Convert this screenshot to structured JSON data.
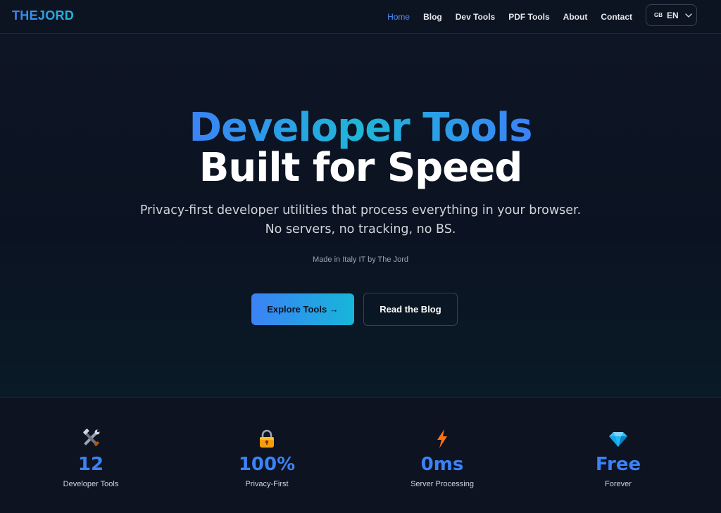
{
  "nav": {
    "brand": "THEJORD",
    "links": [
      "Home",
      "Blog",
      "Dev Tools",
      "PDF Tools",
      "About",
      "Contact"
    ],
    "active": "Home",
    "lang_flag": "GB",
    "lang_code": "EN"
  },
  "hero": {
    "title_line1": "Developer Tools",
    "title_line2": "Built for Speed",
    "subtitle_line1": "Privacy-first developer utilities that process everything in your browser.",
    "subtitle_line2": "No servers, no tracking, no BS.",
    "made_in": "Made in Italy IT by The Jord",
    "primary_button": "Explore Tools →",
    "secondary_button": "Read the Blog"
  },
  "stats": [
    {
      "icon": "tools-icon",
      "value": "12",
      "label": "Developer Tools"
    },
    {
      "icon": "lock-icon",
      "value": "100%",
      "label": "Privacy-First"
    },
    {
      "icon": "lightning-icon",
      "value": "0ms",
      "label": "Server Processing"
    },
    {
      "icon": "diamond-icon",
      "value": "Free",
      "label": "Forever"
    }
  ],
  "colors": {
    "accent_blue": "#3b82f6",
    "accent_cyan": "#16b6d9",
    "background": "#0b1220"
  }
}
